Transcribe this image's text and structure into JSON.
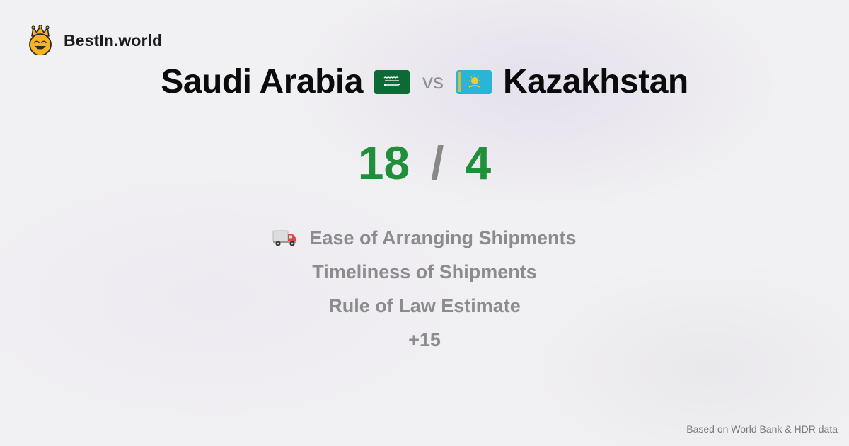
{
  "brand": {
    "name": "BestIn.world",
    "logo_icon": "crown-smiley-icon"
  },
  "comparison": {
    "left_country": "Saudi Arabia",
    "left_flag": "saudi-arabia-flag-icon",
    "vs_label": "vs",
    "right_country": "Kazakhstan",
    "right_flag": "kazakhstan-flag-icon"
  },
  "score": {
    "left": "18",
    "separator": "/",
    "right": "4"
  },
  "metrics": [
    {
      "label": "Ease of Arranging Shipments",
      "icon": "delivery-truck-icon"
    },
    {
      "label": "Timeliness of Shipments"
    },
    {
      "label": "Rule of Law Estimate"
    },
    {
      "label": "+15"
    }
  ],
  "footer": {
    "source": "Based on World Bank & HDR data"
  },
  "colors": {
    "score_green": "#1f8f3a",
    "muted_gray": "#8c8c8f",
    "title_black": "#0b0b0c"
  }
}
